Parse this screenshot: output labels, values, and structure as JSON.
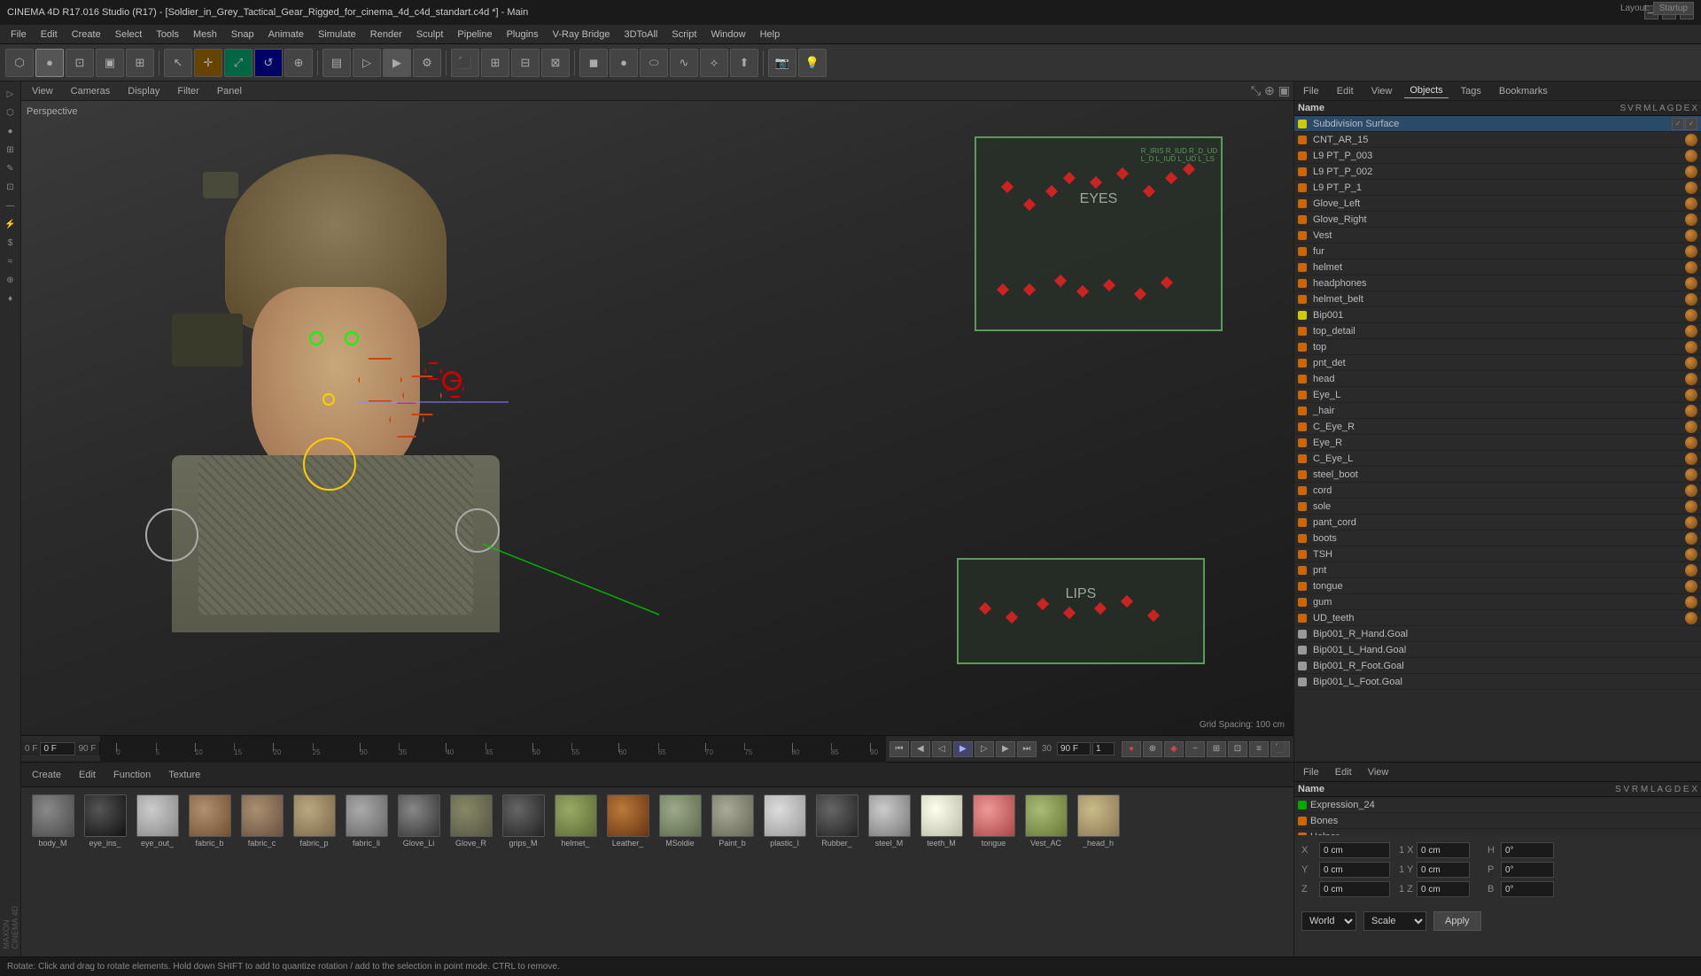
{
  "window": {
    "title": "CINEMA 4D R17.016 Studio (R17) - [Soldier_in_Grey_Tactical_Gear_Rigged_for_cinema_4d_c4d_standart.c4d *] - Main",
    "minimize": "—",
    "maximize": "□",
    "close": "✕"
  },
  "menu": {
    "items": [
      "File",
      "Edit",
      "Create",
      "Select",
      "Tools",
      "Mesh",
      "Snap",
      "Animate",
      "Simulate",
      "Render",
      "Sculpt",
      "Pipeline",
      "Plugins",
      "V-Ray Bridge",
      "3DToAll",
      "Script",
      "Window",
      "Help"
    ]
  },
  "layout": {
    "label": "Layout:",
    "preset": "Startup"
  },
  "viewport": {
    "tabs": [
      "View",
      "Cameras",
      "Display",
      "Filter",
      "Panel"
    ],
    "label": "Perspective",
    "grid_spacing": "Grid Spacing: 100 cm",
    "eyes_label": "EYES",
    "lips_label": "LIPS"
  },
  "right_panel": {
    "tabs": [
      "File",
      "Edit",
      "View",
      "Objects",
      "Tags",
      "Bookmarks"
    ],
    "top_item": "Subdivision Surface",
    "objects": [
      {
        "name": "CNT_AR_15",
        "indent": 0,
        "dot": "orange"
      },
      {
        "name": "L9 PT_P_003",
        "indent": 0,
        "dot": "orange"
      },
      {
        "name": "L9 PT_P_002",
        "indent": 0,
        "dot": "orange"
      },
      {
        "name": "L9 PT_P_1",
        "indent": 0,
        "dot": "orange"
      },
      {
        "name": "Glove_Left",
        "indent": 0,
        "dot": "orange"
      },
      {
        "name": "Glove_Right",
        "indent": 0,
        "dot": "orange"
      },
      {
        "name": "Vest",
        "indent": 0,
        "dot": "orange"
      },
      {
        "name": "fur",
        "indent": 0,
        "dot": "orange"
      },
      {
        "name": "helmet",
        "indent": 0,
        "dot": "orange"
      },
      {
        "name": "headphones",
        "indent": 0,
        "dot": "orange"
      },
      {
        "name": "helmet_belt",
        "indent": 0,
        "dot": "orange"
      },
      {
        "name": "Bip001",
        "indent": 0,
        "dot": "orange"
      },
      {
        "name": "top_detail",
        "indent": 0,
        "dot": "orange"
      },
      {
        "name": "top",
        "indent": 0,
        "dot": "orange"
      },
      {
        "name": "pnt_det",
        "indent": 0,
        "dot": "orange"
      },
      {
        "name": "head",
        "indent": 0,
        "dot": "orange"
      },
      {
        "name": "Eye_L",
        "indent": 0,
        "dot": "orange"
      },
      {
        "name": "_hair",
        "indent": 0,
        "dot": "orange"
      },
      {
        "name": "C_Eye_R",
        "indent": 0,
        "dot": "orange"
      },
      {
        "name": "Eye_R",
        "indent": 0,
        "dot": "orange"
      },
      {
        "name": "C_Eye_L",
        "indent": 0,
        "dot": "orange"
      },
      {
        "name": "steel_boot",
        "indent": 0,
        "dot": "orange"
      },
      {
        "name": "cord",
        "indent": 0,
        "dot": "orange"
      },
      {
        "name": "sole",
        "indent": 0,
        "dot": "orange"
      },
      {
        "name": "pant_cord",
        "indent": 0,
        "dot": "orange"
      },
      {
        "name": "boots",
        "indent": 0,
        "dot": "orange"
      },
      {
        "name": "TSH",
        "indent": 0,
        "dot": "orange"
      },
      {
        "name": "pnt",
        "indent": 0,
        "dot": "orange"
      },
      {
        "name": "tongue",
        "indent": 0,
        "dot": "orange"
      },
      {
        "name": "gum",
        "indent": 0,
        "dot": "orange"
      },
      {
        "name": "UD_teeth",
        "indent": 0,
        "dot": "orange"
      },
      {
        "name": "Bip001_R_Hand.Goal",
        "indent": 0,
        "dot": "light"
      },
      {
        "name": "Bip001_L_Hand.Goal",
        "indent": 0,
        "dot": "light"
      },
      {
        "name": "Bip001_R_Foot.Goal",
        "indent": 0,
        "dot": "light"
      },
      {
        "name": "Bip001_L_Foot.Goal",
        "indent": 0,
        "dot": "light"
      }
    ],
    "name_header": "Name",
    "col_headers": [
      "S",
      "V",
      "R",
      "M",
      "L",
      "A",
      "G",
      "D",
      "E",
      "X"
    ]
  },
  "bottom_right_panel": {
    "tabs": [
      "File",
      "Edit",
      "View"
    ],
    "scene_objects": [
      {
        "name": "Expression_24",
        "dot": "green"
      },
      {
        "name": "Bones",
        "dot": "orange"
      },
      {
        "name": "Helper",
        "dot": "orange"
      }
    ],
    "coords": {
      "x_val": "0 cm",
      "x_label": "X",
      "y_val": "0 cm",
      "y_label": "Y",
      "z_val": "0 cm",
      "z_label": "Z",
      "h_val": "0°",
      "h_label": "H",
      "p_val": "0°",
      "p_label": "P",
      "b_val": "0°",
      "b_label": "B",
      "sx_val": "1 X",
      "sy_val": "1 Y",
      "sz_val": "1 Z"
    },
    "transform_world": "World",
    "transform_scale": "Scale",
    "apply_label": "Apply"
  },
  "material_panel": {
    "toolbar_items": [
      "Create",
      "Edit",
      "Function",
      "Texture"
    ],
    "materials": [
      {
        "name": "body_M",
        "color": "#5a5a5a"
      },
      {
        "name": "eye_ins_",
        "color": "#2a2a2a"
      },
      {
        "name": "eye_out_",
        "color": "#888888"
      },
      {
        "name": "fabric_b",
        "color": "#8b7355"
      },
      {
        "name": "fabric_c",
        "color": "#7a6a55"
      },
      {
        "name": "fabric_p",
        "color": "#9a8a6a"
      },
      {
        "name": "fabric_li",
        "color": "#7a7a7a"
      },
      {
        "name": "Glove_Li",
        "color": "#555555"
      },
      {
        "name": "Glove_R",
        "color": "#666644"
      },
      {
        "name": "grips_M",
        "color": "#444444"
      },
      {
        "name": "helmet_",
        "color": "#778866"
      },
      {
        "name": "Leather_",
        "color": "#8B5A2B"
      },
      {
        "name": "MSoldie",
        "color": "#6a7a6a"
      },
      {
        "name": "Paint_b",
        "color": "#888877"
      },
      {
        "name": "plastic_l",
        "color": "#aaaaaa"
      },
      {
        "name": "Rubber_",
        "color": "#444444"
      },
      {
        "name": "steel_M",
        "color": "#999999"
      },
      {
        "name": "teeth_M",
        "color": "#eeeecc"
      },
      {
        "name": "tongue",
        "color": "#cc7777"
      },
      {
        "name": "Vest_AC",
        "color": "#778866"
      },
      {
        "name": "_head_h",
        "color": "#aa9977"
      }
    ]
  },
  "timeline": {
    "current_frame": "0 F",
    "end_frame": "90 F",
    "fps": "30",
    "ticks": [
      "0",
      "5",
      "10",
      "15",
      "20",
      "25",
      "30",
      "35",
      "40",
      "45",
      "50",
      "55",
      "60",
      "65",
      "70",
      "75",
      "80",
      "85",
      "90"
    ],
    "frame_field": "0 F",
    "step_field": "1"
  },
  "status_bar": {
    "text": "Rotate: Click and drag to rotate elements. Hold down SHIFT to add to quantize rotation / add to the selection in point mode. CTRL to remove."
  }
}
